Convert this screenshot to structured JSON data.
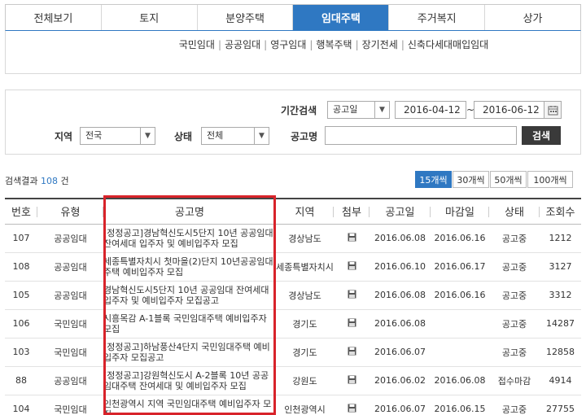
{
  "tabs": [
    {
      "label": "전체보기",
      "active": false
    },
    {
      "label": "토지",
      "active": false
    },
    {
      "label": "분양주택",
      "active": false
    },
    {
      "label": "임대주택",
      "active": true
    },
    {
      "label": "주거복지",
      "active": false
    },
    {
      "label": "상가",
      "active": false
    }
  ],
  "subnav": [
    "국민임대",
    "공공임대",
    "영구임대",
    "행복주택",
    "장기전세",
    "신축다세대매입임대"
  ],
  "search": {
    "period_label": "기간검색",
    "period_type": "공고일",
    "date_from": "2016-04-12",
    "date_sep": "~",
    "date_to": "2016-06-12",
    "region_label": "지역",
    "region_value": "전국",
    "status_label": "상태",
    "status_value": "전체",
    "notice_label": "공고명",
    "notice_value": "",
    "button": "검색"
  },
  "result": {
    "prefix": "검색결과",
    "count": "108",
    "suffix": "건"
  },
  "perpage": [
    {
      "label": "15개씩",
      "active": true
    },
    {
      "label": "30개씩",
      "active": false
    },
    {
      "label": "50개씩",
      "active": false
    },
    {
      "label": "100개씩",
      "active": false
    }
  ],
  "table": {
    "headers": [
      "번호",
      "유형",
      "공고명",
      "지역",
      "첨부",
      "공고일",
      "마감일",
      "상태",
      "조회수"
    ],
    "rows": [
      {
        "no": "107",
        "type": "공공임대",
        "title": "[정정공고]경남혁신도시5단지 10년 공공임대 잔여세대 입주자 및 예비입주자 모집",
        "region": "경상남도",
        "post": "2016.06.08",
        "close": "2016.06.16",
        "status": "공고중",
        "views": "1212"
      },
      {
        "no": "108",
        "type": "공공임대",
        "title": "세종특별자치시 첫마을(2)단지 10년공공임대주택 예비입주자 모집",
        "region": "세종특별자치시",
        "post": "2016.06.10",
        "close": "2016.06.17",
        "status": "공고중",
        "views": "3127"
      },
      {
        "no": "105",
        "type": "공공임대",
        "title": "경남혁신도시5단지 10년 공공임대 잔여세대 입주자 및 예비입주자 모집공고",
        "region": "경상남도",
        "post": "2016.06.08",
        "close": "2016.06.16",
        "status": "공고중",
        "views": "3312"
      },
      {
        "no": "106",
        "type": "국민임대",
        "title": "시흥목감 A-1블록 국민임대주택 예비입주자 모집",
        "region": "경기도",
        "post": "2016.06.08",
        "close": "",
        "status": "공고중",
        "views": "14287"
      },
      {
        "no": "103",
        "type": "국민임대",
        "title": "[정정공고]하남풍산4단지 국민임대주택 예비입주자 모집공고",
        "region": "경기도",
        "post": "2016.06.07",
        "close": "",
        "status": "공고중",
        "views": "12858"
      },
      {
        "no": "88",
        "type": "공공임대",
        "title": "[정정공고]강원혁신도시 A-2블록 10년 공공임대주택 잔여세대 및 예비입주자 모집",
        "region": "강원도",
        "post": "2016.06.02",
        "close": "2016.06.08",
        "status": "접수마감",
        "views": "4914"
      },
      {
        "no": "104",
        "type": "국민임대",
        "title": "인천광역시 지역 국민임대주택 예비입주자 모집",
        "region": "인천광역시",
        "post": "2016.06.07",
        "close": "2016.06.15",
        "status": "공고중",
        "views": "27755"
      }
    ]
  }
}
